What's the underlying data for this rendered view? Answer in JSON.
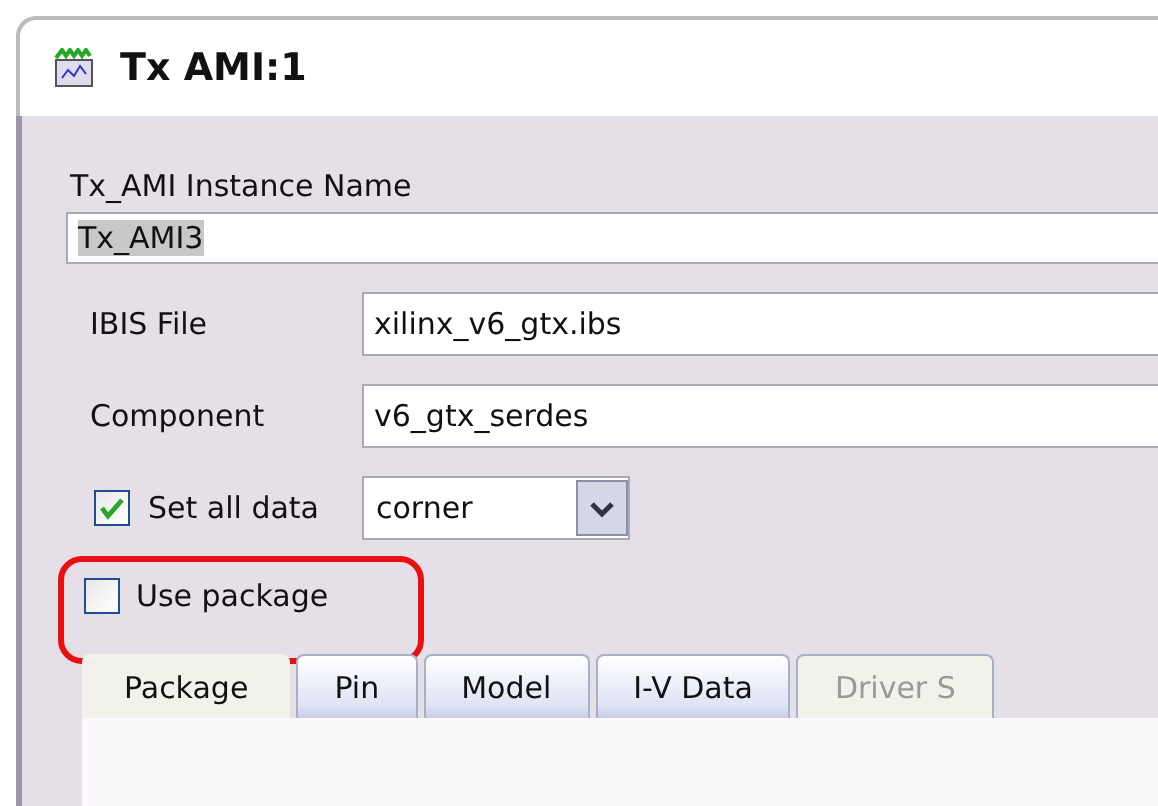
{
  "window": {
    "title": "Tx AMI:1"
  },
  "instance_name": {
    "label": "Tx_AMI Instance Name",
    "value": "Tx_AMI3"
  },
  "fields": [
    {
      "label": "IBIS File",
      "value": "xilinx_v6_gtx.ibs"
    },
    {
      "label": "Component",
      "value": "v6_gtx_serdes"
    }
  ],
  "set_all_data": {
    "label": "Set all data",
    "checked": true,
    "value": "corner"
  },
  "use_package": {
    "label": "Use package",
    "checked": false,
    "highlighted": true
  },
  "tabs": [
    {
      "label": "Package",
      "selected": true,
      "disabled": false
    },
    {
      "label": "Pin",
      "selected": false,
      "disabled": false
    },
    {
      "label": "Model",
      "selected": false,
      "disabled": false
    },
    {
      "label": "I-V Data",
      "selected": false,
      "disabled": false
    },
    {
      "label": "Driver S",
      "selected": false,
      "disabled": true
    }
  ]
}
